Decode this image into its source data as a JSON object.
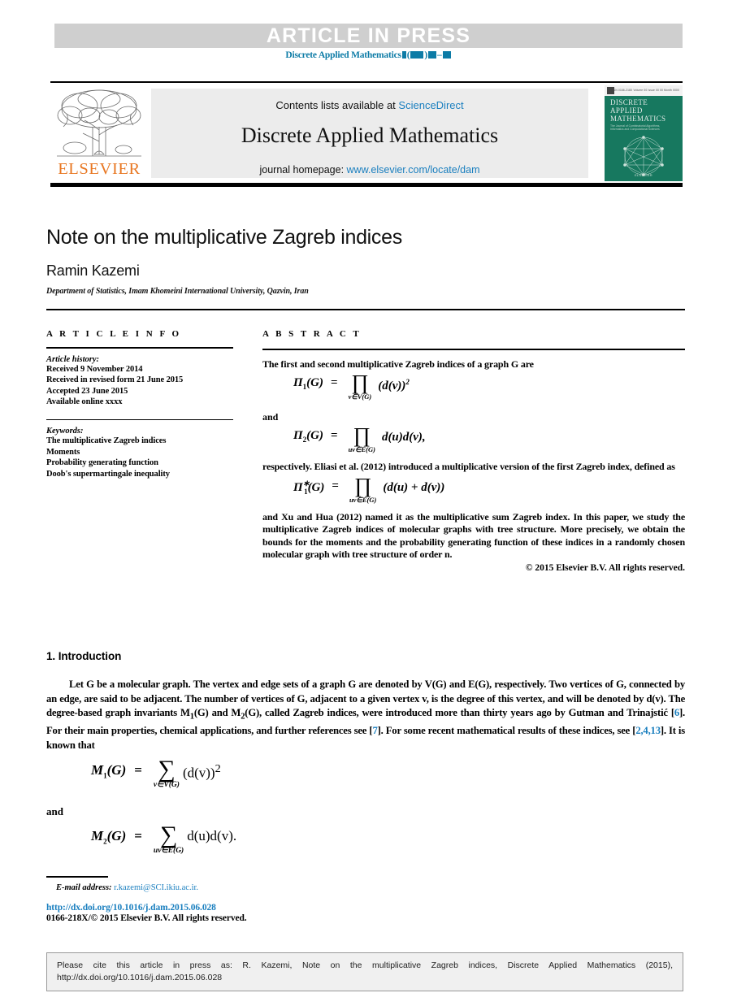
{
  "banner": {
    "text": "ARTICLE  IN  PRESS",
    "journal_ref_prefix": "Discrete Applied Mathematics",
    "journal_ref_masked": "■ (■■■) ■■–■■",
    "band_color": "#cfcfcf",
    "ref_color": "#0c7ba6"
  },
  "masthead": {
    "publisher": "ELSEVIER",
    "contents_prefix": "Contents lists available at",
    "contents_link": "ScienceDirect",
    "journal_title": "Discrete Applied Mathematics",
    "homepage_prefix": "journal homepage:",
    "homepage_link": "www.elsevier.com/locate/dam",
    "link_color": "#1a7fbf",
    "cover": {
      "top_bar_text": "ISSN 0166-218X   Volume 00   Issue 00   00 Month 0000",
      "title_lines": [
        "DISCRETE",
        "APPLIED",
        "MATHEMATICS"
      ],
      "subtitle": "The Journal of Combinatorial Algorithms, Informatics and Computational Sciences",
      "footer": "ELSEVIER",
      "background": "#17785f"
    }
  },
  "article": {
    "title": "Note on the multiplicative Zagreb indices",
    "author": "Ramin Kazemi",
    "affiliation": "Department of Statistics, Imam Khomeini International University, Qazvin, Iran"
  },
  "info": {
    "heading": "A R T I C L E   I N F O",
    "history_label": "Article history:",
    "history": [
      "Received 9 November 2014",
      "Received in revised form 21 June 2015",
      "Accepted 23 June 2015",
      "Available online xxxx"
    ],
    "keywords_label": "Keywords:",
    "keywords": [
      "The multiplicative Zagreb indices",
      "Moments",
      "Probability generating function",
      "Doob's supermartingale inequality"
    ]
  },
  "abstract": {
    "heading": "A B S T R A C T",
    "p1": "The first and second multiplicative Zagreb indices of a graph G are",
    "eq1": {
      "lhs": "Π",
      "lhs_sub": "1",
      "lhs_arg": "(G)",
      "op": "∏",
      "op_sub": "v∈V(G)",
      "rhs": "(d(v))",
      "rhs_sup": "2"
    },
    "and1": "and",
    "eq2": {
      "lhs": "Π",
      "lhs_sub": "2",
      "lhs_arg": "(G)",
      "op": "∏",
      "op_sub": "uv∈E(G)",
      "rhs": "d(u)d(v),",
      "rhs_sup": ""
    },
    "p2": "respectively. Eliasi et al. (2012) introduced a multiplicative version of the first Zagreb index, defined as",
    "eq3": {
      "lhs": "Π",
      "lhs_sub": "1",
      "lhs_sup": "∗",
      "lhs_arg": "(G)",
      "op": "∏",
      "op_sub": "uv∈E(G)",
      "rhs": "(d(u) + d(v))",
      "rhs_sup": ""
    },
    "p3": "and Xu and Hua (2012) named it as the multiplicative sum Zagreb index. In this paper, we study the multiplicative Zagreb indices of molecular graphs with tree structure. More precisely, we obtain the bounds for the moments and the probability generating function of these indices in a randomly chosen molecular graph with tree structure of order n.",
    "copyright": "© 2015 Elsevier B.V. All rights reserved."
  },
  "introduction": {
    "heading": "1.  Introduction",
    "paragraph_parts": [
      "Let G be a molecular graph. The vertex and edge sets of a graph G are denoted by V(G) and E(G), respectively. Two vertices of G, connected by an edge, are said to be adjacent. The number of vertices of G, adjacent to a given vertex v, is the degree of this vertex, and will be denoted by d(v). The degree-based graph invariants M",
      "1",
      "(G) and M",
      "2",
      "(G), called Zagreb indices, were introduced more than thirty years ago by Gutman and Trinajstić [",
      "6",
      "]. For their main properties, chemical applications, and further references see [",
      "7",
      "]. For some recent mathematical results of these indices, see [",
      "2,4,13",
      "]. It is known that"
    ],
    "refs": {
      "r1": "6",
      "r2": "7",
      "r3": "2,4,13"
    },
    "eq4": {
      "lhs": "M",
      "lhs_sub": "1",
      "lhs_arg": "(G)",
      "op": "∑",
      "op_sub": "v∈V(G)",
      "rhs": "(d(v))",
      "rhs_sup": "2"
    },
    "and": "and",
    "eq5": {
      "lhs": "M",
      "lhs_sub": "2",
      "lhs_arg": "(G)",
      "op": "∑",
      "op_sub": "uv∈E(G)",
      "rhs": "d(u)d(v).",
      "rhs_sup": ""
    }
  },
  "footnote": {
    "email_label": "E-mail address:",
    "email": "r.kazemi@SCI.ikiu.ac.ir.",
    "doi": "http://dx.doi.org/10.1016/j.dam.2015.06.028",
    "issn": "0166-218X/© 2015 Elsevier B.V. All rights reserved.",
    "link_color": "#1a7fbf"
  },
  "citation_box": {
    "line1": "Please cite this article in press as: R. Kazemi, Note on the multiplicative Zagreb indices, Discrete Applied Mathematics (2015),",
    "line2": "http://dx.doi.org/10.1016/j.dam.2015.06.028"
  }
}
